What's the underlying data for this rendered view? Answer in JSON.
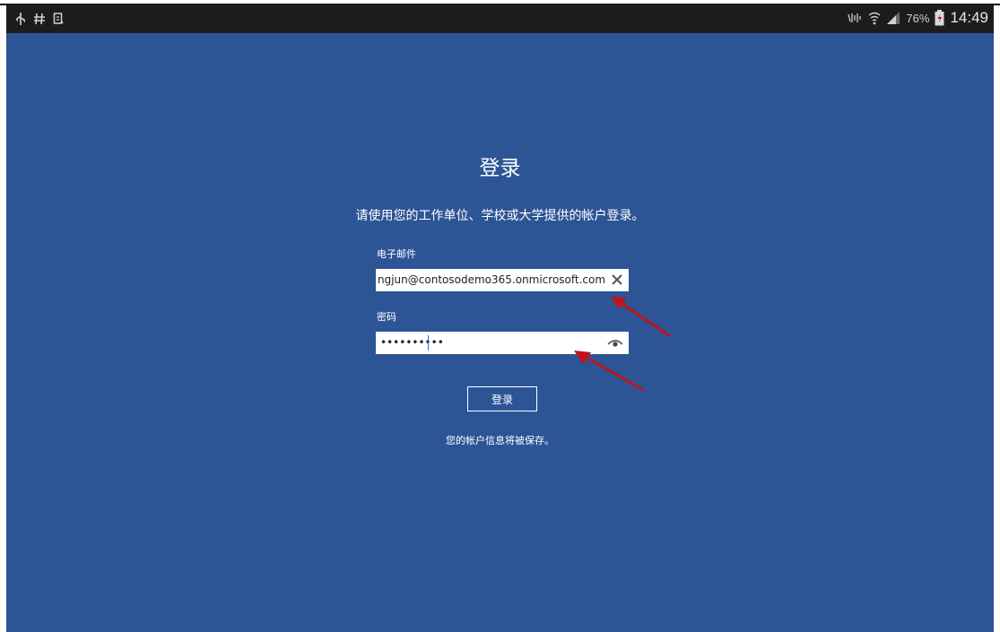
{
  "status_bar": {
    "left_icons": [
      "usb-icon",
      "hash-icon",
      "clipboard-icon"
    ],
    "right_icons": [
      "signal-mute-icon",
      "wifi-icon",
      "cell-signal-icon",
      "battery-icon"
    ],
    "battery_percent": "76%",
    "time": "14:49"
  },
  "signin": {
    "title": "登录",
    "subtitle": "请使用您的工作单位、学校或大学提供的帐户登录。",
    "email_label": "电子邮件",
    "email_value": "ngjun@contosodemo365.onmicrosoft.com",
    "password_label": "密码",
    "password_value": "••••••••••",
    "button_label": "登录",
    "saved_note": "您的帐户信息将被保存。"
  },
  "colors": {
    "background": "#2d5596",
    "status_bar": "#1c1c1c",
    "annotation_arrow": "#c0141a"
  },
  "icons": {
    "clear": "close-icon",
    "reveal_password": "eye-icon"
  }
}
